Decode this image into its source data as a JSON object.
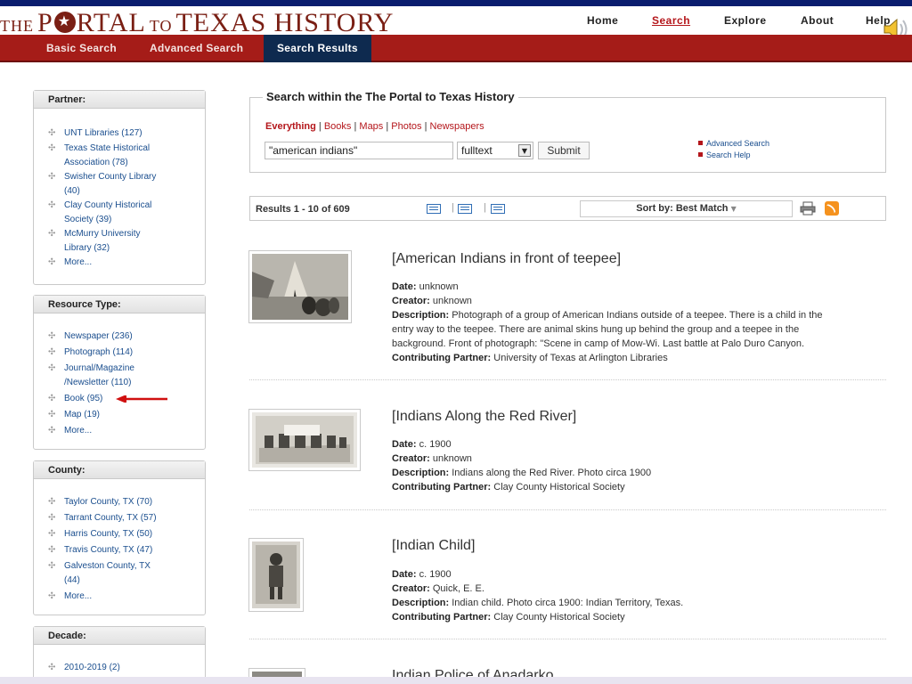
{
  "header": {
    "logo_the": "THE",
    "logo_portal_p": "P",
    "logo_portal_rest": "RTAL",
    "logo_to": "TO",
    "logo_texas_history": "TEXAS HISTORY",
    "nav": [
      "Home",
      "Search",
      "Explore",
      "About",
      "Help"
    ],
    "active_nav": "Search"
  },
  "subnav": {
    "items": [
      "Basic Search",
      "Advanced Search",
      "Search Results"
    ],
    "active": "Search Results"
  },
  "sidebar": {
    "partner": {
      "title": "Partner:",
      "items": [
        "UNT Libraries (127)",
        "Texas State Historical",
        "Association (78)",
        "Swisher County Library",
        "(40)",
        "Clay County Historical",
        "Society (39)",
        "McMurry University",
        "Library (32)",
        "More..."
      ]
    },
    "resource_type": {
      "title": "Resource Type:",
      "items": [
        "Newspaper (236)",
        "Photograph (114)",
        "Journal/Magazine",
        "/Newsletter (110)",
        "Book (95)",
        "Map (19)",
        "More..."
      ]
    },
    "county": {
      "title": "County:",
      "items": [
        "Taylor County, TX (70)",
        "Tarrant County, TX (57)",
        "Harris County, TX (50)",
        "Travis County, TX (47)",
        "Galveston County, TX",
        "(44)",
        "More..."
      ]
    },
    "decade": {
      "title": "Decade:",
      "items": [
        "2010-2019 (2)"
      ]
    }
  },
  "search": {
    "legend": "Search within the The Portal to Texas History",
    "filters": [
      "Everything",
      "Books",
      "Maps",
      "Photos",
      "Newspapers"
    ],
    "selected_filter": "Everything",
    "query_value": "\"american indians\"",
    "field_value": "fulltext",
    "submit_label": "Submit",
    "links": [
      "Advanced Search",
      "Search Help"
    ]
  },
  "results_bar": {
    "count_text": "Results 1 - 10 of 609",
    "sort_text": "Sort by: Best Match"
  },
  "results": [
    {
      "title": "[American Indians in front of teepee]",
      "date_label": "Date:",
      "date": "unknown",
      "creator_label": "Creator:",
      "creator": "unknown",
      "description_label": "Description:",
      "description_lines": [
        "Photograph of a group of American Indians outside of a teepee. There is a child in the",
        "entry way to the teepee. There are animal skins hung up behind the group and a teepee in the",
        "background. Front of photograph: \"Scene in camp of Mow-Wi. Last battle at Palo Duro Canyon."
      ],
      "partner_label": "Contributing Partner:",
      "partner": "University of Texas at Arlington Libraries"
    },
    {
      "title": "[Indians Along the Red River]",
      "date_label": "Date:",
      "date": "c. 1900",
      "creator_label": "Creator:",
      "creator": "unknown",
      "description_label": "Description:",
      "description_lines": [
        "Indians along the Red River. Photo circa 1900"
      ],
      "partner_label": "Contributing Partner:",
      "partner": "Clay County Historical Society"
    },
    {
      "title": "[Indian Child]",
      "date_label": "Date:",
      "date": "c. 1900",
      "creator_label": "Creator:",
      "creator": "Quick, E. E.",
      "description_label": "Description:",
      "description_lines": [
        "Indian child. Photo circa 1900: Indian Territory, Texas."
      ],
      "partner_label": "Contributing Partner:",
      "partner": "Clay County Historical Society"
    },
    {
      "title": "Indian Police of Anadarko"
    }
  ],
  "colors": {
    "brand_red": "#a51c18",
    "logo_maroon": "#7a1f14",
    "active_tab": "#0e2a4f",
    "link_blue": "#1a4e8e",
    "annotation_arrow": "#d01010"
  }
}
